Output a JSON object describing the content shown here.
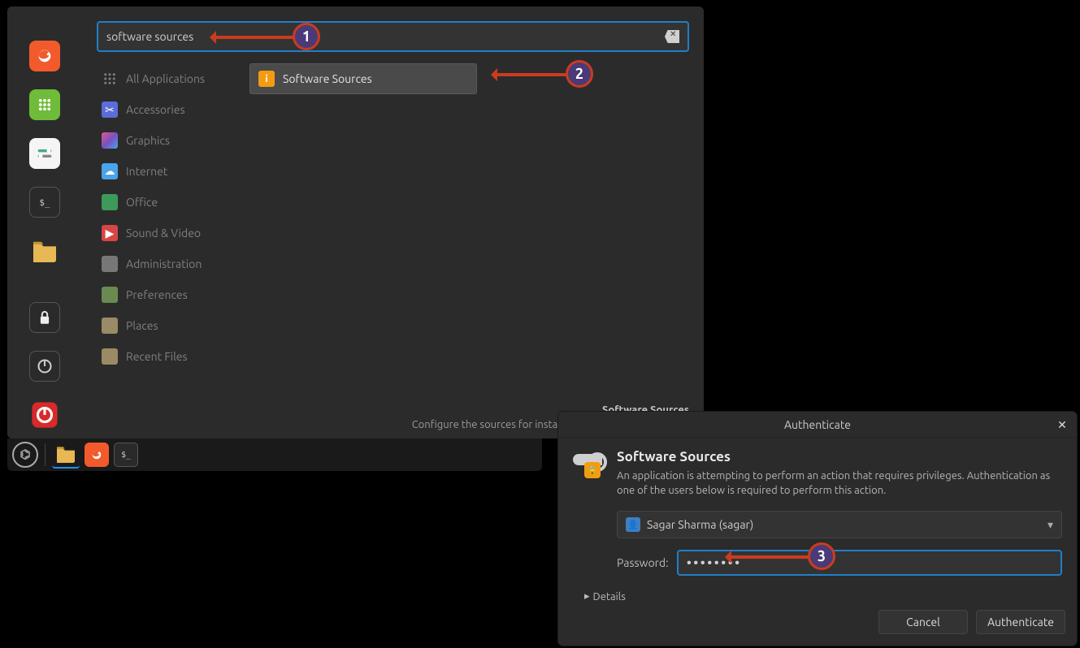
{
  "menu": {
    "search_value": "software sources",
    "categories": [
      {
        "label": "All Applications",
        "icon": "grid",
        "color": "#808080"
      },
      {
        "label": "Accessories",
        "icon": "scissors",
        "color": "#5a6dd8"
      },
      {
        "label": "Graphics",
        "icon": "palette",
        "color": "#c050a0"
      },
      {
        "label": "Internet",
        "icon": "cloud",
        "color": "#4aa3eb"
      },
      {
        "label": "Office",
        "icon": "doc",
        "color": "#3d9a5a"
      },
      {
        "label": "Sound & Video",
        "icon": "play",
        "color": "#d84545"
      },
      {
        "label": "Administration",
        "icon": "drawer",
        "color": "#777"
      },
      {
        "label": "Preferences",
        "icon": "sliders",
        "color": "#6a8a52"
      },
      {
        "label": "Places",
        "icon": "folder",
        "color": "#9a8a65"
      },
      {
        "label": "Recent Files",
        "icon": "folder",
        "color": "#9a8a65"
      }
    ],
    "results": [
      {
        "label": "Software Sources"
      }
    ],
    "footer_title": "Software Sources",
    "footer_desc": "Configure the sources for installable software and updates"
  },
  "launcher": [
    {
      "name": "firefox-icon",
      "bg": "#f25a2c",
      "glyph": "firefox"
    },
    {
      "name": "apps-icon",
      "bg": "#6fbb3a",
      "glyph": "grid"
    },
    {
      "name": "settings-icon",
      "bg": "#f5f5f5",
      "glyph": "toggles"
    },
    {
      "name": "terminal-icon",
      "bg": "#2a2a2a",
      "glyph": "terminal"
    },
    {
      "name": "files-icon",
      "bg": "none",
      "glyph": "folder"
    },
    {
      "name": "lock-icon",
      "bg": "#2a2a2a",
      "glyph": "lock"
    },
    {
      "name": "logout-icon",
      "bg": "#2a2a2a",
      "glyph": "logout"
    },
    {
      "name": "power-icon",
      "bg": "none",
      "glyph": "power"
    }
  ],
  "taskbar": {
    "items": [
      {
        "name": "files-task",
        "glyph": "folder",
        "active": true
      },
      {
        "name": "firefox-task",
        "glyph": "firefox",
        "active": false
      },
      {
        "name": "terminal-task",
        "glyph": "terminal",
        "active": false
      }
    ]
  },
  "auth": {
    "titlebar": "Authenticate",
    "heading": "Software Sources",
    "desc": "An application is attempting to perform an action that requires privileges. Authentication as one of the users below is required to perform this action.",
    "user": "Sagar Sharma (sagar)",
    "password_label": "Password:",
    "password_value": "••••••••",
    "details": "Details",
    "cancel": "Cancel",
    "ok": "Authenticate"
  },
  "annotations": {
    "n1": "1",
    "n2": "2",
    "n3": "3"
  }
}
